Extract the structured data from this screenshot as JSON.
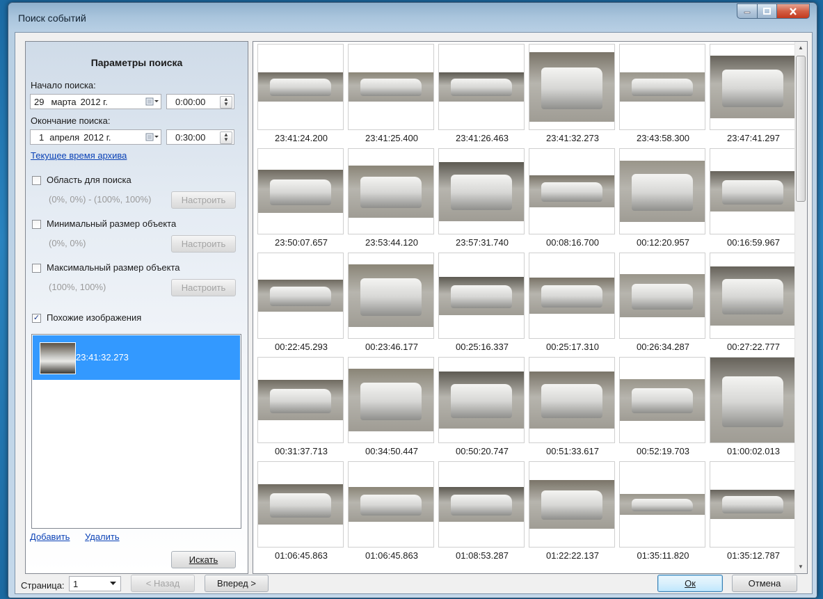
{
  "window": {
    "title": "Поиск событий"
  },
  "search_panel": {
    "title": "Параметры поиска",
    "start_label": "Начало поиска:",
    "start_day": "29",
    "start_month": "марта",
    "start_year": "2012 г.",
    "start_time": "0:00:00",
    "end_label": "Окончание поиска:",
    "end_day": "1",
    "end_month": "апреля",
    "end_year": "2012 г.",
    "end_time": "0:30:00",
    "current_time_link": "Текущее время архива",
    "area": {
      "label": "Область для поиска",
      "checked": false,
      "value": "(0%, 0%) - (100%, 100%)",
      "button": "Настроить"
    },
    "min_size": {
      "label": "Минимальный размер объекта",
      "checked": false,
      "value": "(0%, 0%)",
      "button": "Настроить"
    },
    "max_size": {
      "label": "Максимальный размер объекта",
      "checked": false,
      "value": "(100%, 100%)",
      "button": "Настроить"
    },
    "similar": {
      "label": "Похожие изображения",
      "checked": true,
      "items": [
        "23:41:32.273"
      ]
    },
    "add_link": "Добавить",
    "remove_link": "Удалить",
    "search_button": "Искать"
  },
  "results": {
    "timestamps": [
      "23:41:24.200",
      "23:41:25.400",
      "23:41:26.463",
      "23:41:32.273",
      "23:43:58.300",
      "23:47:41.297",
      "23:50:07.657",
      "23:53:44.120",
      "23:57:31.740",
      "00:08:16.700",
      "00:12:20.957",
      "00:16:59.967",
      "00:22:45.293",
      "00:23:46.177",
      "00:25:16.337",
      "00:25:17.310",
      "00:26:34.287",
      "00:27:22.777",
      "00:31:37.713",
      "00:34:50.447",
      "00:50:20.747",
      "00:51:33.617",
      "00:52:19.703",
      "01:00:02.013",
      "01:06:45.863",
      "01:06:45.863",
      "01:08:53.287",
      "01:22:22.137",
      "01:35:11.820",
      "01:35:12.787"
    ]
  },
  "footer": {
    "page_label": "Страница:",
    "page_value": "1",
    "prev_button": "< Назад",
    "next_button": "Вперед >",
    "ok_button": "Ок",
    "cancel_button": "Отмена"
  },
  "icons": [
    "minimize-icon",
    "maximize-icon",
    "close-icon",
    "calendar-icon",
    "spin-icon",
    "dropdown-arrow-icon",
    "scroll-up-icon",
    "scroll-down-icon"
  ],
  "colors": {
    "selection": "#3399ff",
    "link": "#0b42b6",
    "close": "#c33a1f"
  }
}
